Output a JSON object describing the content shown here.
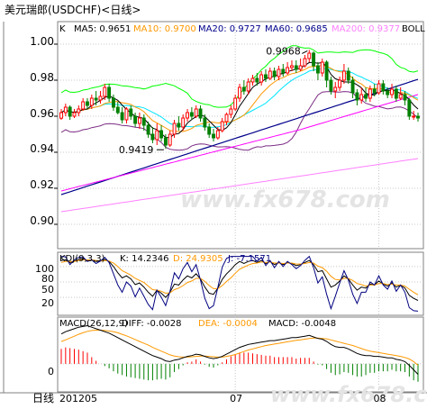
{
  "title": "美元瑞郎(USDCHF)<日线>",
  "watermark": "www.fx678.com",
  "colors": {
    "bg": "#ffffff",
    "frame": "#808080",
    "grid": "#c8c8c8",
    "text": "#000000",
    "up": "#ff0000",
    "down": "#008000",
    "ma5": "#000000",
    "ma10": "#ff9900",
    "ma20": "#ff00ff",
    "ma60": "#00008b",
    "ma200": "#ff80ff",
    "boll": "#808080",
    "boll_upper": "#00ff00",
    "boll_lower": "#7b2c83",
    "boll_mid": "#00e5ff",
    "kdj_k": "#000000",
    "kdj_d": "#ff9900",
    "kdj_j": "#000080",
    "macd_diff": "#000000",
    "macd_dea": "#ff9900",
    "macd_pos": "#ff0000",
    "macd_neg": "#008000"
  },
  "chart_data": [
    {
      "type": "candlestick",
      "panel": "main",
      "legend": {
        "k": "K",
        "ma5": "MA5: 0.9651",
        "ma10": "MA10: 0.9700",
        "ma20": "MA20: 0.9727",
        "ma60": "MA60: 0.9685",
        "ma200": "MA200: 0.9377",
        "boll": "BOLL"
      },
      "y_ticks": [
        "1.00",
        "0.98",
        "0.96",
        "0.94",
        "0.92",
        "0.90"
      ],
      "ylim": [
        0.8865,
        1.0125
      ],
      "annotations": [
        {
          "text": "0.9968",
          "index": 57,
          "value": 0.9968
        },
        {
          "text": "0.9419",
          "index": 24,
          "value": 0.9419
        }
      ],
      "candles": [
        [
          0.9589,
          0.962,
          0.958,
          0.964
        ],
        [
          0.962,
          0.965,
          0.96,
          0.967
        ],
        [
          0.965,
          0.96,
          0.958,
          0.966
        ],
        [
          0.96,
          0.962,
          0.959,
          0.964
        ],
        [
          0.962,
          0.964,
          0.96,
          0.966
        ],
        [
          0.964,
          0.968,
          0.963,
          0.97
        ],
        [
          0.968,
          0.966,
          0.964,
          0.97
        ],
        [
          0.966,
          0.97,
          0.964,
          0.972
        ],
        [
          0.97,
          0.969,
          0.966,
          0.974
        ],
        [
          0.969,
          0.971,
          0.967,
          0.974
        ],
        [
          0.971,
          0.976,
          0.969,
          0.978
        ],
        [
          0.976,
          0.97,
          0.968,
          0.978
        ],
        [
          0.97,
          0.965,
          0.963,
          0.972
        ],
        [
          0.965,
          0.962,
          0.961,
          0.968
        ],
        [
          0.962,
          0.958,
          0.956,
          0.965
        ],
        [
          0.958,
          0.964,
          0.956,
          0.965
        ],
        [
          0.964,
          0.96,
          0.958,
          0.966
        ],
        [
          0.96,
          0.956,
          0.954,
          0.962
        ],
        [
          0.956,
          0.959,
          0.953,
          0.962
        ],
        [
          0.959,
          0.955,
          0.952,
          0.961
        ],
        [
          0.955,
          0.95,
          0.948,
          0.957
        ],
        [
          0.95,
          0.947,
          0.945,
          0.954
        ],
        [
          0.947,
          0.952,
          0.944,
          0.956
        ],
        [
          0.952,
          0.948,
          0.946,
          0.955
        ],
        [
          0.948,
          0.944,
          0.9419,
          0.95
        ],
        [
          0.944,
          0.95,
          0.943,
          0.952
        ],
        [
          0.95,
          0.956,
          0.948,
          0.958
        ],
        [
          0.956,
          0.954,
          0.952,
          0.96
        ],
        [
          0.954,
          0.959,
          0.952,
          0.961
        ],
        [
          0.959,
          0.962,
          0.957,
          0.964
        ],
        [
          0.962,
          0.96,
          0.958,
          0.965
        ],
        [
          0.96,
          0.964,
          0.959,
          0.966
        ],
        [
          0.964,
          0.959,
          0.957,
          0.966
        ],
        [
          0.959,
          0.954,
          0.952,
          0.961
        ],
        [
          0.954,
          0.95,
          0.948,
          0.956
        ],
        [
          0.95,
          0.948,
          0.946,
          0.953
        ],
        [
          0.948,
          0.952,
          0.947,
          0.954
        ],
        [
          0.952,
          0.957,
          0.951,
          0.959
        ],
        [
          0.957,
          0.961,
          0.955,
          0.962
        ],
        [
          0.961,
          0.964,
          0.959,
          0.966
        ],
        [
          0.964,
          0.97,
          0.963,
          0.972
        ],
        [
          0.97,
          0.976,
          0.968,
          0.978
        ],
        [
          0.976,
          0.974,
          0.972,
          0.98
        ],
        [
          0.974,
          0.979,
          0.972,
          0.981
        ],
        [
          0.979,
          0.981,
          0.977,
          0.983
        ],
        [
          0.981,
          0.979,
          0.977,
          0.984
        ],
        [
          0.979,
          0.983,
          0.977,
          0.985
        ],
        [
          0.983,
          0.981,
          0.979,
          0.986
        ],
        [
          0.981,
          0.985,
          0.98,
          0.987
        ],
        [
          0.985,
          0.982,
          0.98,
          0.987
        ],
        [
          0.982,
          0.986,
          0.98,
          0.988
        ],
        [
          0.986,
          0.984,
          0.982,
          0.989
        ],
        [
          0.984,
          0.987,
          0.983,
          0.99
        ],
        [
          0.987,
          0.988,
          0.985,
          0.991
        ],
        [
          0.988,
          0.986,
          0.984,
          0.991
        ],
        [
          0.986,
          0.988,
          0.985,
          0.992
        ],
        [
          0.988,
          0.992,
          0.987,
          0.994
        ],
        [
          0.992,
          0.995,
          0.99,
          0.9968
        ],
        [
          0.995,
          0.988,
          0.985,
          0.996
        ],
        [
          0.988,
          0.984,
          0.98,
          0.99
        ],
        [
          0.984,
          0.99,
          0.982,
          0.992
        ],
        [
          0.99,
          0.98,
          0.976,
          0.991
        ],
        [
          0.98,
          0.974,
          0.972,
          0.982
        ],
        [
          0.974,
          0.976,
          0.97,
          0.979
        ],
        [
          0.976,
          0.98,
          0.974,
          0.982
        ],
        [
          0.98,
          0.985,
          0.978,
          0.989
        ],
        [
          0.985,
          0.98,
          0.978,
          0.987
        ],
        [
          0.98,
          0.973,
          0.97,
          0.982
        ],
        [
          0.973,
          0.969,
          0.966,
          0.975
        ],
        [
          0.969,
          0.972,
          0.967,
          0.976
        ],
        [
          0.972,
          0.97,
          0.968,
          0.976
        ],
        [
          0.97,
          0.975,
          0.968,
          0.977
        ],
        [
          0.975,
          0.973,
          0.971,
          0.978
        ],
        [
          0.973,
          0.978,
          0.972,
          0.98
        ],
        [
          0.978,
          0.974,
          0.972,
          0.98
        ],
        [
          0.974,
          0.972,
          0.97,
          0.976
        ],
        [
          0.972,
          0.975,
          0.97,
          0.978
        ],
        [
          0.975,
          0.97,
          0.968,
          0.977
        ],
        [
          0.97,
          0.972,
          0.969,
          0.976
        ],
        [
          0.972,
          0.969,
          0.966,
          0.974
        ],
        [
          0.969,
          0.96,
          0.958,
          0.97
        ],
        [
          0.96,
          0.96,
          0.958,
          0.963
        ],
        [
          0.96,
          0.959,
          0.957,
          0.962
        ]
      ]
    },
    {
      "type": "line",
      "panel": "kdj",
      "legend": {
        "name": "KDJ(9,3,3)",
        "k": "K: 14.2346",
        "d": "D: 24.9305",
        "j": "J: -7.1571"
      },
      "y_ticks": [
        "100",
        "80",
        "50",
        "20"
      ],
      "ylim": [
        -15,
        108
      ],
      "series": [
        {
          "name": "K",
          "values": [
            92,
            93,
            88,
            91,
            94,
            95,
            92,
            93,
            90,
            91,
            94,
            90,
            80,
            68,
            58,
            62,
            56,
            45,
            48,
            40,
            30,
            22,
            34,
            28,
            20,
            30,
            46,
            44,
            54,
            62,
            58,
            66,
            56,
            40,
            28,
            26,
            38,
            55,
            66,
            74,
            84,
            90,
            86,
            90,
            92,
            88,
            92,
            86,
            90,
            84,
            88,
            84,
            88,
            86,
            82,
            84,
            88,
            92,
            84,
            70,
            72,
            56,
            40,
            44,
            52,
            62,
            56,
            44,
            34,
            40,
            38,
            46,
            44,
            52,
            46,
            42,
            48,
            40,
            44,
            38,
            24,
            18,
            14
          ]
        },
        {
          "name": "D",
          "values": [
            88,
            90,
            90,
            90,
            92,
            93,
            93,
            93,
            92,
            91,
            92,
            91,
            87,
            80,
            72,
            68,
            63,
            57,
            53,
            49,
            42,
            35,
            34,
            32,
            28,
            29,
            35,
            38,
            43,
            49,
            52,
            57,
            57,
            51,
            43,
            37,
            37,
            43,
            51,
            58,
            67,
            75,
            79,
            83,
            86,
            87,
            89,
            88,
            89,
            87,
            87,
            86,
            87,
            87,
            85,
            85,
            86,
            88,
            87,
            81,
            78,
            71,
            61,
            55,
            54,
            57,
            57,
            53,
            47,
            45,
            42,
            44,
            44,
            47,
            47,
            45,
            46,
            44,
            44,
            42,
            36,
            30,
            25
          ]
        },
        {
          "name": "J",
          "values": [
            100,
            99,
            84,
            93,
            98,
            99,
            90,
            93,
            86,
            91,
            98,
            88,
            66,
            44,
            30,
            50,
            42,
            21,
            38,
            22,
            6,
            -4,
            34,
            20,
            4,
            32,
            68,
            56,
            76,
            88,
            70,
            84,
            54,
            18,
            -2,
            4,
            40,
            79,
            96,
            100,
            100,
            100,
            100,
            100,
            100,
            90,
            98,
            82,
            92,
            78,
            90,
            80,
            90,
            84,
            76,
            82,
            92,
            100,
            78,
            48,
            60,
            26,
            -2,
            22,
            48,
            72,
            54,
            26,
            8,
            30,
            30,
            50,
            44,
            62,
            44,
            36,
            52,
            32,
            44,
            30,
            0,
            -6,
            -7
          ]
        }
      ]
    },
    {
      "type": "bar",
      "panel": "macd",
      "legend": {
        "name": "MACD(26,12,9)",
        "diff": "DIFF: -0.0028",
        "dea": "DEA: -0.0004",
        "macd": "MACD: -0.0048"
      },
      "y_ticks": [
        "0"
      ],
      "ylim": [
        -0.0075,
        0.0125
      ],
      "series": [
        {
          "name": "DIFF",
          "values": [
            0.008,
            0.0086,
            0.009,
            0.0094,
            0.0098,
            0.01,
            0.0102,
            0.0098,
            0.0094,
            0.009,
            0.0086,
            0.0082,
            0.0076,
            0.007,
            0.0064,
            0.0058,
            0.0052,
            0.0046,
            0.004,
            0.0034,
            0.0028,
            0.0022,
            0.0018,
            0.0014,
            0.0008,
            0.0006,
            0.001,
            0.0012,
            0.0016,
            0.002,
            0.0022,
            0.0026,
            0.0024,
            0.002,
            0.0016,
            0.0014,
            0.0016,
            0.002,
            0.0026,
            0.0032,
            0.0038,
            0.0044,
            0.0048,
            0.0052,
            0.0054,
            0.0056,
            0.0058,
            0.006,
            0.0062,
            0.0062,
            0.0064,
            0.0066,
            0.0068,
            0.007,
            0.007,
            0.0072,
            0.0074,
            0.0076,
            0.0072,
            0.0068,
            0.0066,
            0.006,
            0.0052,
            0.0046,
            0.0044,
            0.0044,
            0.004,
            0.0034,
            0.0028,
            0.0024,
            0.0022,
            0.0022,
            0.002,
            0.002,
            0.0018,
            0.0016,
            0.0016,
            0.0012,
            0.001,
            0.0006,
            -0.0004,
            -0.0016,
            -0.0028
          ]
        },
        {
          "name": "DEA",
          "values": [
            0.006,
            0.0064,
            0.0069,
            0.0074,
            0.0079,
            0.0083,
            0.0087,
            0.0089,
            0.009,
            0.009,
            0.0089,
            0.0088,
            0.0086,
            0.0083,
            0.0079,
            0.0075,
            0.007,
            0.0065,
            0.006,
            0.0055,
            0.005,
            0.0044,
            0.0039,
            0.0034,
            0.0029,
            0.0024,
            0.0021,
            0.0019,
            0.0018,
            0.0018,
            0.0019,
            0.002,
            0.0021,
            0.0021,
            0.002,
            0.0019,
            0.0018,
            0.0018,
            0.002,
            0.0022,
            0.0025,
            0.0029,
            0.0033,
            0.0037,
            0.004,
            0.0043,
            0.0046,
            0.0049,
            0.0051,
            0.0053,
            0.0055,
            0.0057,
            0.0059,
            0.0061,
            0.0063,
            0.0064,
            0.0066,
            0.0068,
            0.0069,
            0.0069,
            0.0068,
            0.0067,
            0.0064,
            0.0061,
            0.0058,
            0.0055,
            0.0052,
            0.0049,
            0.0045,
            0.0041,
            0.0037,
            0.0034,
            0.0032,
            0.003,
            0.0028,
            0.0026,
            0.0024,
            0.0022,
            0.002,
            0.0017,
            0.0013,
            0.0006,
            -0.0004
          ]
        }
      ]
    }
  ],
  "x_axis": {
    "period": "日线",
    "labels": [
      {
        "text": "201205",
        "index": 0
      },
      {
        "text": "07",
        "index": 40
      },
      {
        "text": "08",
        "index": 73
      }
    ]
  }
}
